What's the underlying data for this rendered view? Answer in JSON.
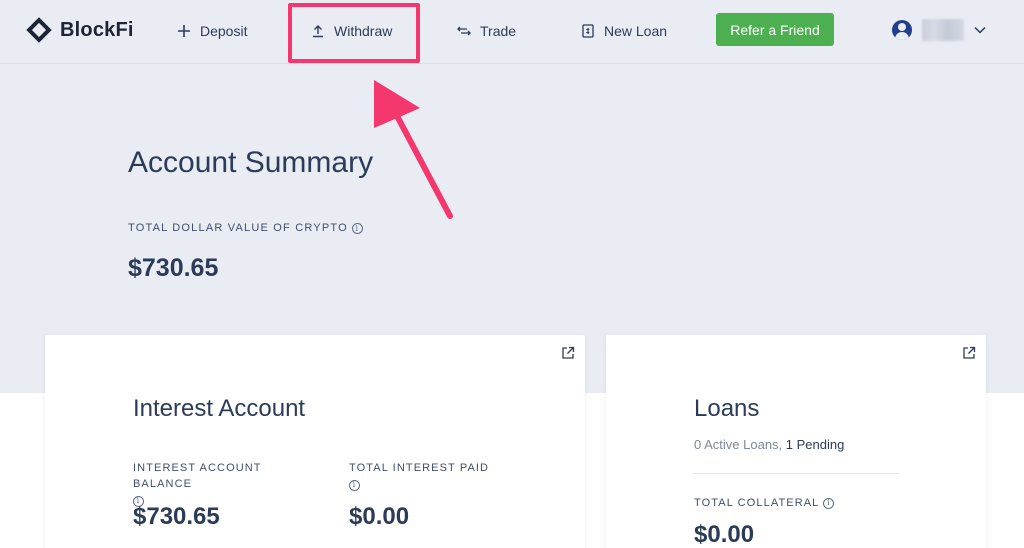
{
  "brand": {
    "name": "BlockFi"
  },
  "nav": {
    "deposit": "Deposit",
    "withdraw": "Withdraw",
    "trade": "Trade",
    "new_loan": "New Loan",
    "refer": "Refer a Friend"
  },
  "colors": {
    "background": "#e9ecf3",
    "accent_green": "#4caf50",
    "highlight_pink": "#f4376d",
    "text_navy": "#2c3b58",
    "avatar_blue": "#1f3f8c"
  },
  "icons": {
    "deposit": "plus-icon",
    "withdraw": "upload-icon",
    "trade": "swap-arrows-icon",
    "new_loan": "document-dollar-icon",
    "user": "user-avatar-icon",
    "menu": "chevron-down-icon",
    "info": "info-icon",
    "open": "external-link-icon"
  },
  "summary": {
    "title": "Account Summary",
    "total_label": "TOTAL DOLLAR VALUE OF CRYPTO",
    "total_value": "$730.65"
  },
  "interest_card": {
    "title": "Interest Account",
    "balance_label": "INTEREST ACCOUNT BALANCE",
    "balance_value": "$730.65",
    "paid_label": "TOTAL INTEREST PAID",
    "paid_value": "$0.00"
  },
  "loans_card": {
    "title": "Loans",
    "active": "0 Active Loans,",
    "pending": "1 Pending",
    "collateral_label": "TOTAL COLLATERAL",
    "collateral_value": "$0.00"
  }
}
